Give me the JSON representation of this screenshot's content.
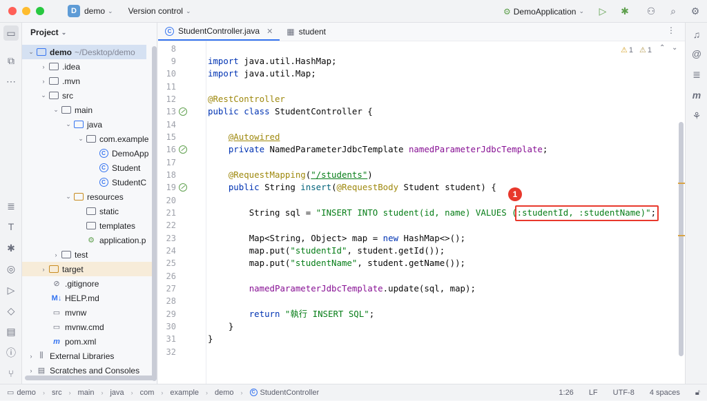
{
  "titlebar": {
    "project_initial": "D",
    "project_name": "demo",
    "vcs_label": "Version control",
    "run_config": "DemoApplication"
  },
  "project_panel": {
    "title": "Project",
    "tree": [
      {
        "label": "demo",
        "extra": "~/Desktop/demo"
      },
      {
        "label": ".idea"
      },
      {
        "label": ".mvn"
      },
      {
        "label": "src"
      },
      {
        "label": "main"
      },
      {
        "label": "java"
      },
      {
        "label": "com.example"
      },
      {
        "label": "DemoApp"
      },
      {
        "label": "Student"
      },
      {
        "label": "StudentC"
      },
      {
        "label": "resources"
      },
      {
        "label": "static"
      },
      {
        "label": "templates"
      },
      {
        "label": "application.p"
      },
      {
        "label": "test"
      },
      {
        "label": "target"
      },
      {
        "label": ".gitignore"
      },
      {
        "label": "HELP.md"
      },
      {
        "label": "mvnw"
      },
      {
        "label": "mvnw.cmd"
      },
      {
        "label": "pom.xml"
      },
      {
        "label": "External Libraries"
      },
      {
        "label": "Scratches and Consoles"
      }
    ]
  },
  "tabs": [
    {
      "label": "StudentController.java",
      "close": "✕"
    },
    {
      "label": "student"
    }
  ],
  "editor": {
    "warnings": [
      {
        "count": "1"
      },
      {
        "count": "1"
      }
    ],
    "line_numbers": [
      "8",
      "9",
      "10",
      "11",
      "12",
      "13",
      "14",
      "15",
      "16",
      "17",
      "18",
      "19",
      "20",
      "21",
      "22",
      "23",
      "24",
      "25",
      "26",
      "27",
      "28",
      "29",
      "30",
      "31",
      "32"
    ],
    "tokens": {
      "import": "import",
      "hashmap_import": " java.util.HashMap;",
      "map_import": " java.util.Map;",
      "rest_controller": "@RestController",
      "public": "public",
      "class": "class",
      "class_decl": " StudentController {",
      "autowired": "@Autowired",
      "private": "private",
      "jdbc_type": " NamedParameterJdbcTemplate ",
      "jdbc_field": "namedParameterJdbcTemplate",
      "semicolon": ";",
      "request_mapping": "@RequestMapping",
      "open_paren": "(",
      "close_paren": ")",
      "mapping_path": "\"/students\"",
      "string_type": " String ",
      "insert_method": "insert",
      "request_body": "@RequestBody",
      "insert_params": " Student student) {",
      "sql_decl": "String sql = ",
      "sql_string": "\"INSERT INTO student(id, name) VALUES (:studentId, :studentName)\"",
      "map_decl_a": "Map<String, Object> map = ",
      "new": "new",
      "map_decl_b": " HashMap<>();",
      "put_a": "map.put(",
      "student_id_key": "\"studentId\"",
      "put_id_rest": ", student.getId());",
      "student_name_key": "\"studentName\"",
      "put_name_rest": ", student.getName());",
      "update_call": ".update(sql, map);",
      "return": "return",
      "return_string": "\"執行 INSERT SQL\"",
      "close_brace": "}"
    }
  },
  "annotation": {
    "callout_number": "1"
  },
  "statusbar": {
    "breadcrumbs": [
      "demo",
      "src",
      "main",
      "java",
      "com",
      "example",
      "demo",
      "StudentController"
    ],
    "position": "1:26",
    "line_ending": "LF",
    "encoding": "UTF-8",
    "indent": "4 spaces"
  },
  "colors": {
    "keyword": "#0033b3",
    "annotation": "#9e880d",
    "string": "#067d17",
    "field": "#871094",
    "highlight_box": "#e8382c",
    "accent": "#3574f0"
  }
}
